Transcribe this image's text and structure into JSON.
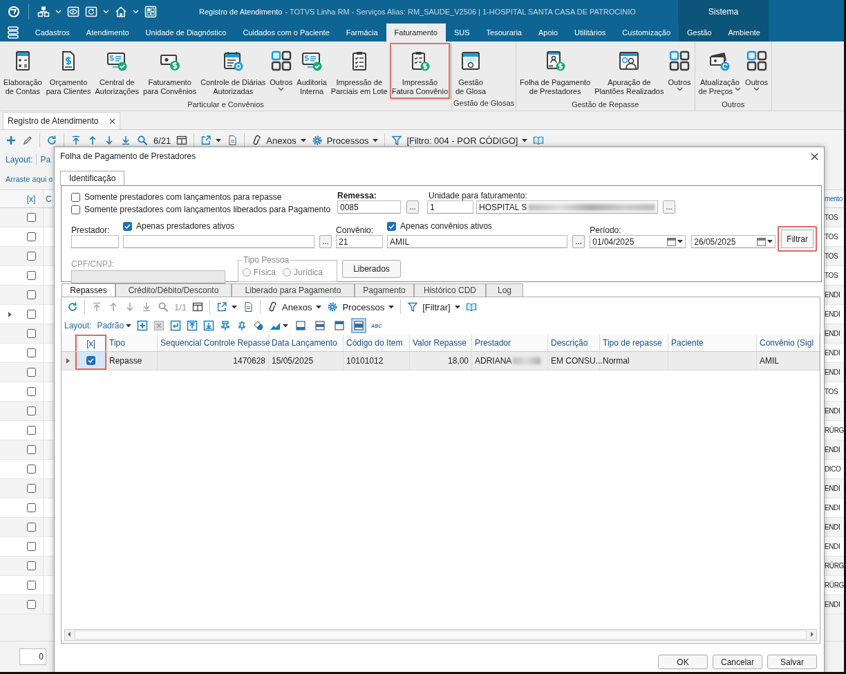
{
  "title_bar": {
    "title": "Registro de Atendimento",
    "subtitle": "- TOTVS Linha RM - Serviços  Alias: RM_SAUDE_V2506 | 1-HOSPITAL SANTA CASA DE PATROCINIO",
    "system_label": "Sistema"
  },
  "menu_tabs": [
    {
      "label": "Cadastros",
      "selected": false,
      "kind": "module"
    },
    {
      "label": "Atendimento",
      "selected": false,
      "kind": "module"
    },
    {
      "label": "Unidade de Diagnóstico",
      "selected": false,
      "kind": "module"
    },
    {
      "label": "Cuidados com o Paciente",
      "selected": false,
      "kind": "module"
    },
    {
      "label": "Farmácia",
      "selected": false,
      "kind": "module"
    },
    {
      "label": "Faturamento",
      "selected": true,
      "kind": "module"
    },
    {
      "label": "SUS",
      "selected": false,
      "kind": "module"
    },
    {
      "label": "Tesouraria",
      "selected": false,
      "kind": "module"
    },
    {
      "label": "Apoio",
      "selected": false,
      "kind": "module"
    },
    {
      "label": "Utilitários",
      "selected": false,
      "kind": "module"
    },
    {
      "label": "Customização",
      "selected": false,
      "kind": "module"
    },
    {
      "label": "Gestão",
      "selected": false,
      "kind": "system"
    },
    {
      "label": "Ambiente",
      "selected": false,
      "kind": "system"
    }
  ],
  "ribbon": {
    "groups": [
      {
        "label": "Particular e Convênios",
        "buttons": [
          {
            "label": "Elaboração\nde Contas",
            "kind": "calculator",
            "dropdown": false,
            "highlighted": false
          },
          {
            "label": "Orçamento\npara Clientes",
            "kind": "document",
            "dropdown": false,
            "highlighted": false
          },
          {
            "label": "Central de\nAutorizações",
            "kind": "approval",
            "dropdown": false,
            "highlighted": false
          },
          {
            "label": "Faturamento\npara Convênios",
            "kind": "payment",
            "dropdown": false,
            "highlighted": false
          },
          {
            "label": "Controle de Diárias\nAutorizadas",
            "kind": "calendar",
            "dropdown": false,
            "highlighted": false
          },
          {
            "label": "Outros",
            "kind": "more",
            "dropdown": true,
            "highlighted": false
          },
          {
            "label": "Auditoria\nInterna",
            "kind": "approval",
            "dropdown": false,
            "highlighted": false
          },
          {
            "label": "Impressão de\nParciais em Lote",
            "kind": "checklist",
            "dropdown": false,
            "highlighted": false
          },
          {
            "label": "Impressão\nFatura Convênio",
            "kind": "printing",
            "dropdown": false,
            "highlighted": true
          }
        ]
      },
      {
        "label": "Gestão de Glosas",
        "buttons": [
          {
            "label": "Gestão\nde Glosa",
            "kind": "glosa",
            "dropdown": false,
            "highlighted": false
          }
        ]
      },
      {
        "label": "Gestão de Repasse",
        "buttons": [
          {
            "label": "Folha de Pagamento\nde Prestadores",
            "kind": "payroll",
            "dropdown": false,
            "highlighted": false
          },
          {
            "label": "Apuração de\nPlantões Realizados",
            "kind": "schedule",
            "dropdown": false,
            "highlighted": false
          },
          {
            "label": "Outros",
            "kind": "more",
            "dropdown": true,
            "highlighted": false
          }
        ]
      },
      {
        "label": "Outros",
        "buttons": [
          {
            "label": "Atualização\nde Preços",
            "kind": "pricing",
            "dropdown": true,
            "highlighted": false
          },
          {
            "label": "Outros",
            "kind": "more",
            "dropdown": true,
            "highlighted": false
          }
        ]
      }
    ]
  },
  "document_tabs": [
    {
      "label": "Registro de Atendimento",
      "selected": true
    }
  ],
  "main_window": {
    "toolbar": {
      "navigation_enabled": true,
      "record_counter": "6/21",
      "attachments": "Anexos",
      "processes": "Processos",
      "filter": "[Filtro: 004 - POR CÓDIGO]"
    },
    "layout_label": "Layout:",
    "layout_value": "Pa",
    "group_hint": "Arraste aqui o",
    "columns": [
      "[x]",
      "C",
      "mento"
    ],
    "rows": [
      {
        "checked": false,
        "current": false,
        "column_3": "TOS"
      },
      {
        "checked": false,
        "current": false,
        "column_3": "TOS"
      },
      {
        "checked": false,
        "current": false,
        "column_3": "TOS"
      },
      {
        "checked": false,
        "current": false,
        "column_3": "TOS"
      },
      {
        "checked": false,
        "current": false,
        "column_3": "ENDI"
      },
      {
        "checked": false,
        "current": true,
        "column_3": "ENDI"
      },
      {
        "checked": false,
        "current": false,
        "column_3": "ENDI"
      },
      {
        "checked": false,
        "current": false,
        "column_3": "ENDI"
      },
      {
        "checked": false,
        "current": false,
        "column_3": "ENDI"
      },
      {
        "checked": false,
        "current": false,
        "column_3": "TOS"
      },
      {
        "checked": false,
        "current": false,
        "column_3": "ENDI"
      },
      {
        "checked": false,
        "current": false,
        "column_3": "RÚRG"
      },
      {
        "checked": false,
        "current": false,
        "column_3": "ENDI"
      },
      {
        "checked": false,
        "current": false,
        "column_3": "DICO"
      },
      {
        "checked": false,
        "current": false,
        "column_3": "ENDI"
      },
      {
        "checked": false,
        "current": false,
        "column_3": "ENDI"
      },
      {
        "checked": false,
        "current": false,
        "column_3": "ENDI"
      },
      {
        "checked": false,
        "current": false,
        "column_3": "ENDI"
      },
      {
        "checked": false,
        "current": false,
        "column_3": "RÚRG"
      },
      {
        "checked": false,
        "current": false,
        "column_3": "RÚRG"
      },
      {
        "checked": false,
        "current": false,
        "column_3": "ENDI"
      }
    ],
    "footer_value": "0"
  },
  "dialog": {
    "title": "Folha de Pagamento de Prestadores",
    "tabs": [
      {
        "label": "Identificação",
        "selected": true
      }
    ],
    "filters": {
      "only_with_repasse": {
        "label": "Somente prestadores com lançamentos para repasse",
        "checked": false
      },
      "only_released": {
        "label": "Somente prestadores com lançamentos liberados para Pagamento",
        "checked": false
      },
      "remessa": {
        "label": "Remessa:",
        "value": "0085",
        "lookup": "..."
      },
      "unidade": {
        "label": "Unidade para faturamento:",
        "code": "1",
        "name": "HOSPITAL S",
        "redacted": true,
        "lookup": "..."
      },
      "prestador": {
        "label": "Prestador:",
        "lookup": "...",
        "active_only": {
          "label": "Apenas prestadores ativos",
          "checked": true
        }
      },
      "convenio": {
        "label": "Convênio:",
        "code": "21",
        "name": "AMIL",
        "lookup": "...",
        "active_only": {
          "label": "Apenas convênios ativos",
          "checked": true
        }
      },
      "periodo": {
        "label": "Período:",
        "start": "01/04/2025",
        "end": "26/05/2025"
      },
      "filter_button": {
        "label": "Filtrar",
        "highlighted": true
      },
      "cpf": {
        "label": "CPF/CNPJ:",
        "disabled": true
      },
      "person_type": {
        "label": "Tipo Pessoa",
        "disabled": true,
        "options": [
          {
            "label": "Física",
            "selected": false
          },
          {
            "label": "Jurídica",
            "selected": false
          }
        ]
      },
      "released_button": {
        "label": "Liberados"
      }
    },
    "sub_tabs": [
      {
        "label": "Repasses",
        "selected": true
      },
      {
        "label": "Crédito/Débito/Desconto",
        "selected": false
      },
      {
        "label": "Liberado para Pagamento",
        "selected": false
      },
      {
        "label": "Pagamento",
        "selected": false
      },
      {
        "label": "Histórico CDD",
        "selected": false
      },
      {
        "label": "Log",
        "selected": false
      }
    ],
    "toolbar": {
      "navigation_enabled": false,
      "record_counter": "1/1",
      "attachments": "Anexos",
      "processes": "Processos",
      "filter": "[Filtrar]"
    },
    "layout_label": "Layout:",
    "layout_value": "Padrão",
    "row_height_options": [
      {
        "selected": false
      },
      {
        "selected": false
      },
      {
        "selected": false
      },
      {
        "selected": true
      }
    ],
    "style_label": "ABC",
    "grid": {
      "columns": [
        {
          "label": "[x]",
          "highlighted": true
        },
        {
          "label": "Tipo",
          "highlighted": false
        },
        {
          "label": "Sequencial Controle Repasse",
          "highlighted": false
        },
        {
          "label": "Data Lançamento",
          "highlighted": false
        },
        {
          "label": "Código do Item",
          "highlighted": false
        },
        {
          "label": "Valor Repasse",
          "highlighted": false
        },
        {
          "label": "Prestador",
          "highlighted": false
        },
        {
          "label": "Descrição",
          "highlighted": false
        },
        {
          "label": "Tipo de repasse",
          "highlighted": false
        },
        {
          "label": "Paciente",
          "highlighted": false
        },
        {
          "label": "Convênio (Sigl",
          "highlighted": false
        }
      ],
      "rows": [
        {
          "current": true,
          "cells": [
            {
              "checked": true
            },
            {
              "text": "Repasse"
            },
            {
              "text": "1470628",
              "numeric": true
            },
            {
              "text": "15/05/2025"
            },
            {
              "text": "10101012"
            },
            {
              "text": "18,00",
              "numeric": true
            },
            {
              "text": "ADRIANA",
              "redacted": true
            },
            {
              "text": "EM CONSU..."
            },
            {
              "text": "Normal"
            },
            {
              "text": null
            },
            {
              "text": "AMIL"
            }
          ]
        }
      ]
    },
    "buttons": [
      {
        "label": "OK"
      },
      {
        "label": "Cancelar"
      },
      {
        "label": "Salvar"
      }
    ]
  }
}
